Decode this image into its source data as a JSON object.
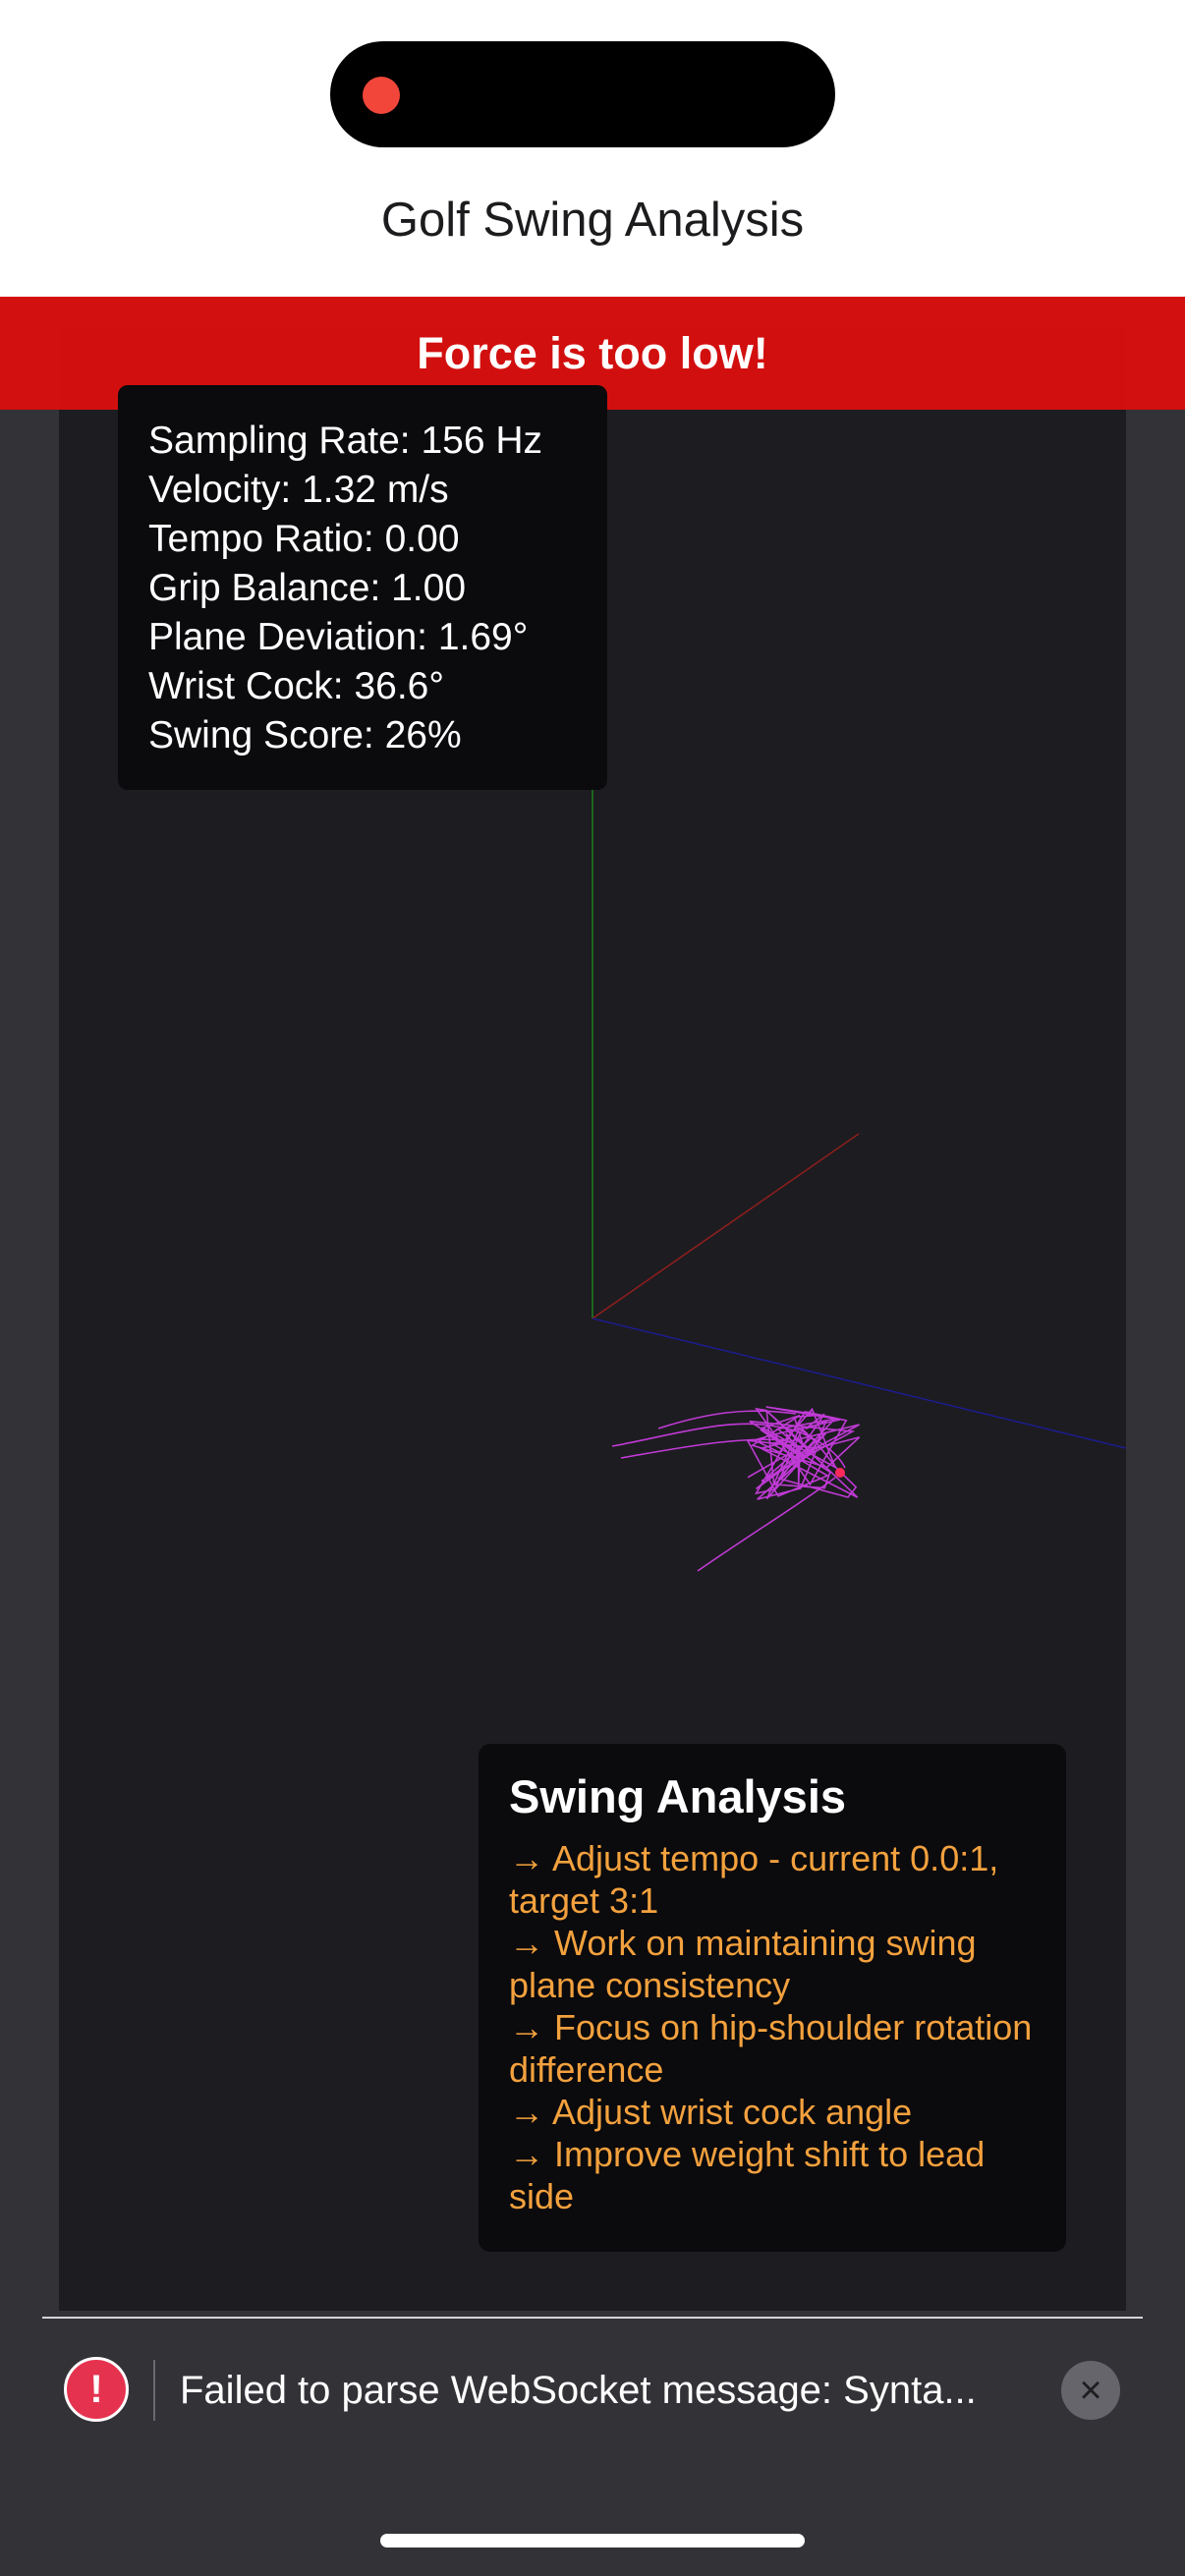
{
  "header": {
    "title": "Golf Swing Analysis"
  },
  "banner": {
    "text": "Force is too low!",
    "color": "#da0f0f"
  },
  "stats": [
    "Sampling Rate: 156 Hz",
    "Velocity: 1.32 m/s",
    "Tempo Ratio: 0.00",
    "Grip Balance: 1.00",
    "Plane Deviation: 1.69°",
    "Wrist Cock: 36.6°",
    "Swing Score: 26%"
  ],
  "analysis": {
    "title": "Swing Analysis",
    "tips": [
      "→ Adjust tempo - current 0.0:1, target 3:1",
      "→ Work on maintaining swing plane consistency",
      "→ Focus on hip-shoulder rotation difference",
      "→ Adjust wrist cock angle",
      "→ Improve weight shift to lead side"
    ],
    "tip_color": "#f3a13e"
  },
  "scene": {
    "axis_colors": {
      "x": "#8b1e1e",
      "y": "#1d7a1d",
      "z": "#1c1c8a"
    },
    "trail_color": "#c03ad6"
  },
  "error_toast": {
    "message": "Failed to parse WebSocket message: Synta...",
    "icon": "exclamation-icon",
    "close_icon": "close-icon"
  }
}
